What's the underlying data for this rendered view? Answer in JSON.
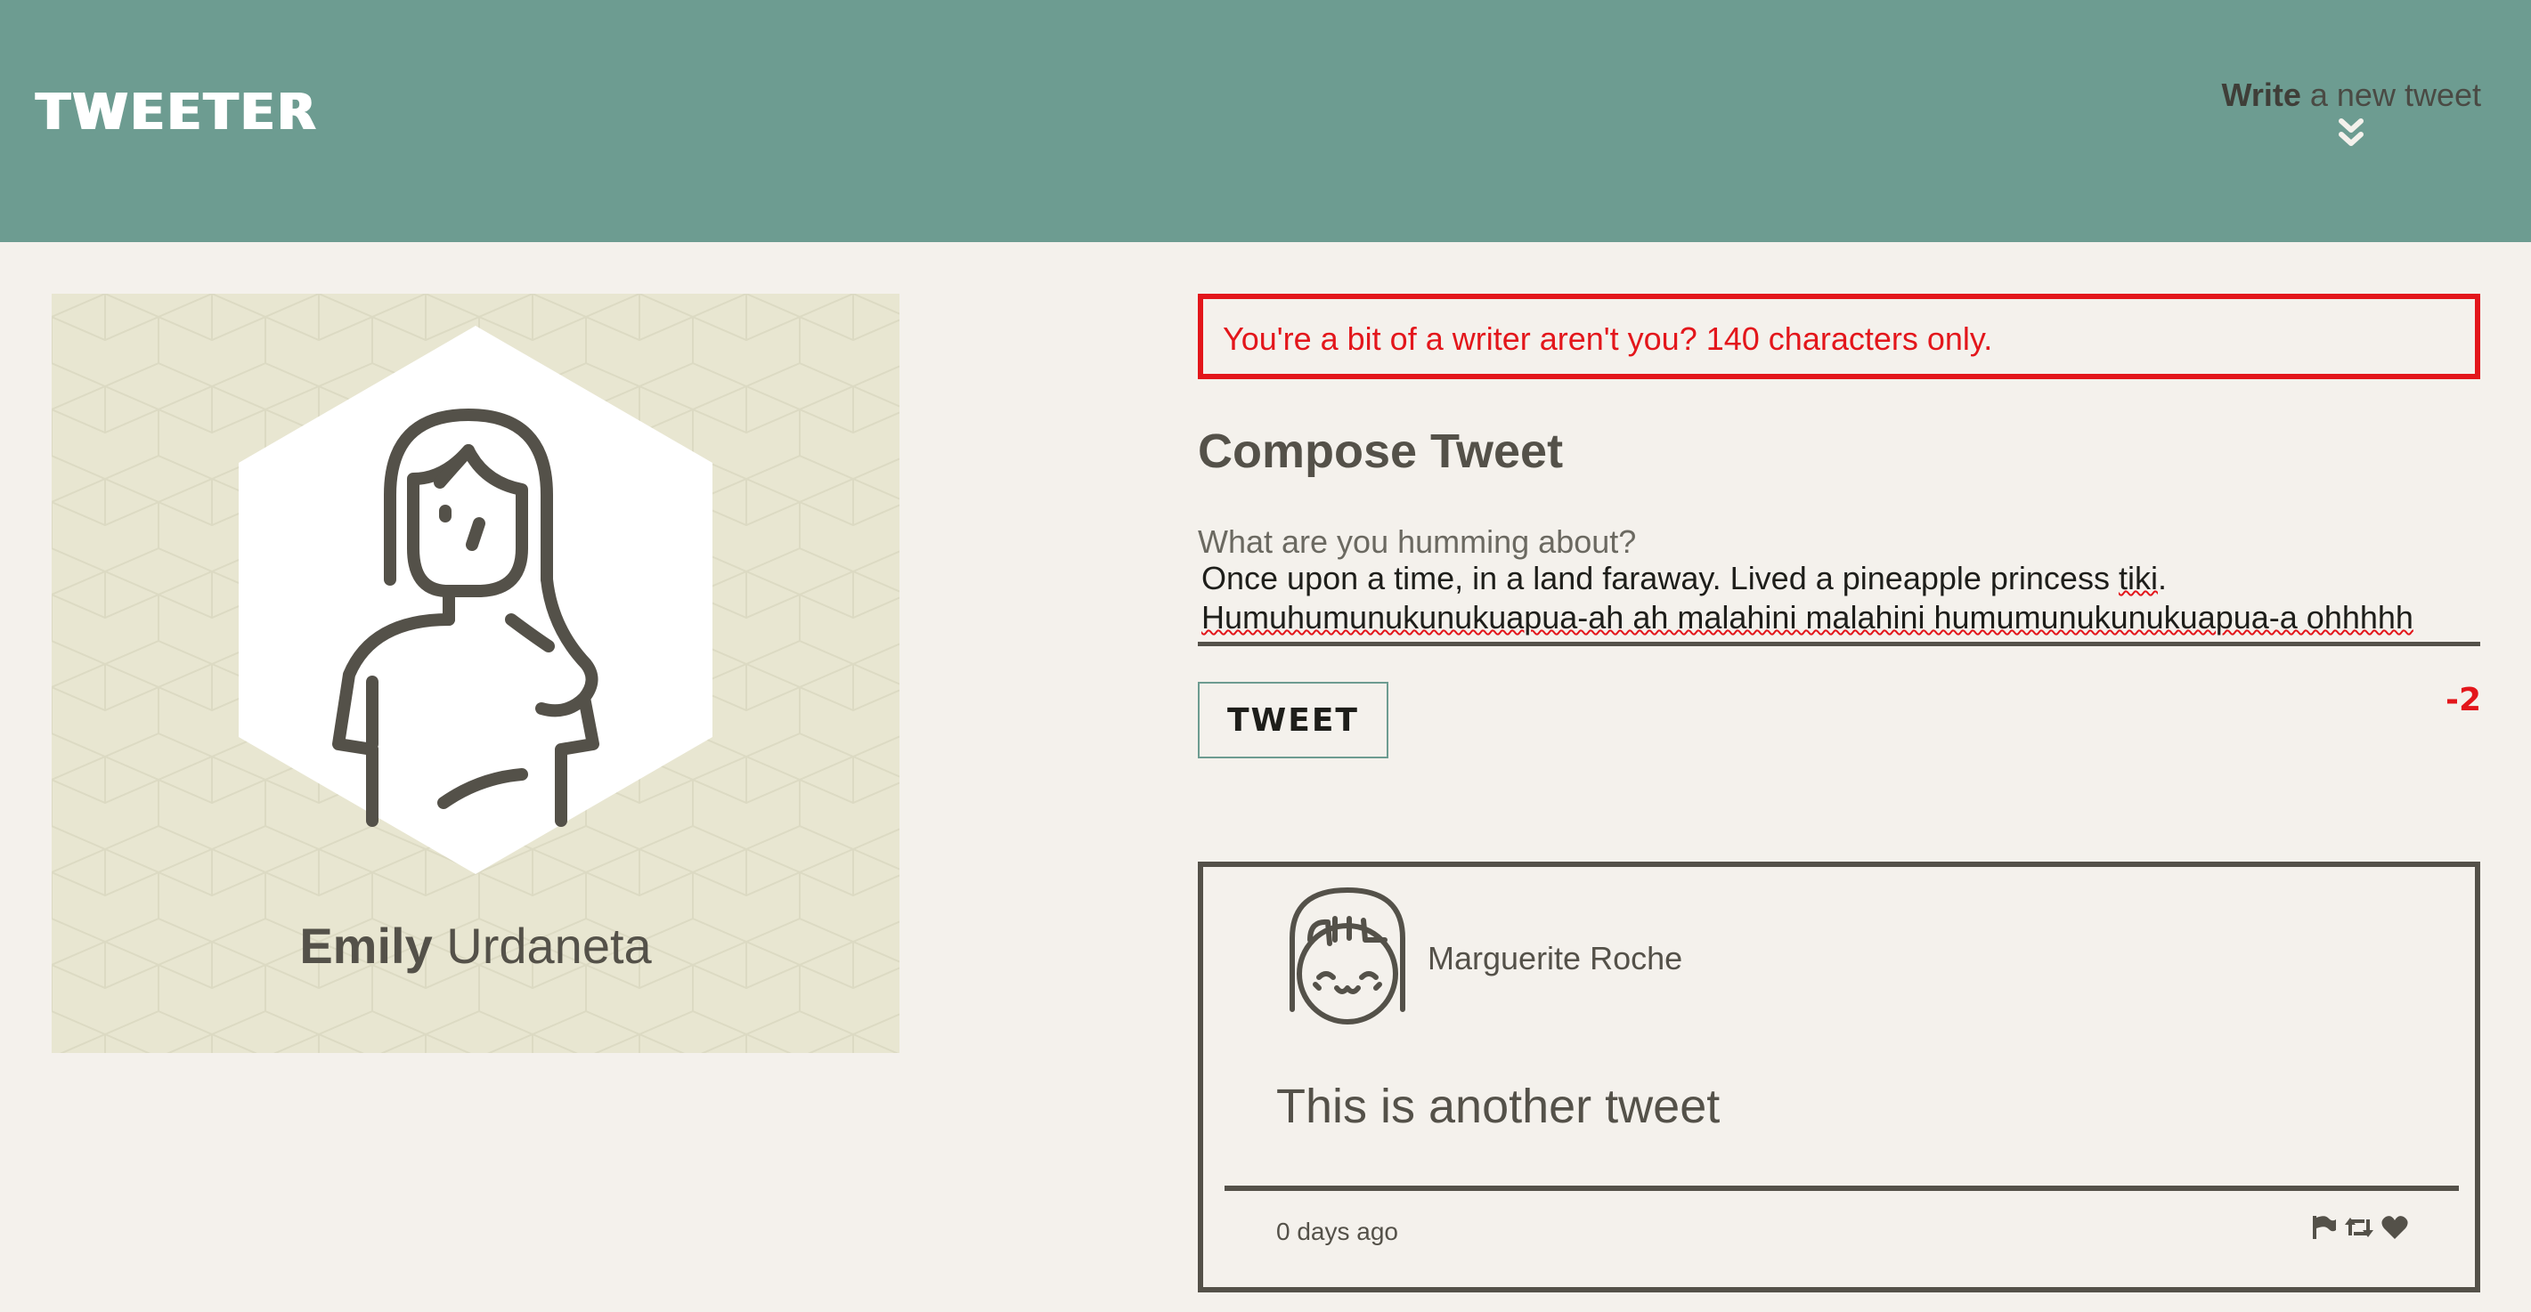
{
  "nav": {
    "brand": "TWEETER",
    "write_bold": "Write",
    "write_rest": " a new tweet"
  },
  "profile": {
    "first_name": "Emily",
    "last_name": " Urdaneta"
  },
  "compose": {
    "error": "You're a bit of a writer aren't you? 140 characters only.",
    "title": "Compose Tweet",
    "label": "What are you humming about?",
    "text_line1": "Once upon a time, in a land faraway. Lived a pineapple princess ",
    "text_wavy1": "tiki",
    "text_line1_end": ".",
    "text_line2": "Humuhumunukunukuapua-ah ah malahini malahini humumunukunukuapua-a ohhhhh",
    "button": "TWEET",
    "counter": "-2"
  },
  "tweets": [
    {
      "author": "Marguerite Roche",
      "content": "This is another tweet",
      "time": "0 days ago"
    }
  ],
  "colors": {
    "nav": "#6d9c91",
    "background": "#f4f1ec",
    "profile_card": "#e8e6d1",
    "text": "#545149",
    "error": "#e3161b"
  },
  "icons": {
    "write": "double-chevron-down-icon",
    "flag": "flag-icon",
    "retweet": "retweet-icon",
    "like": "heart-icon"
  }
}
